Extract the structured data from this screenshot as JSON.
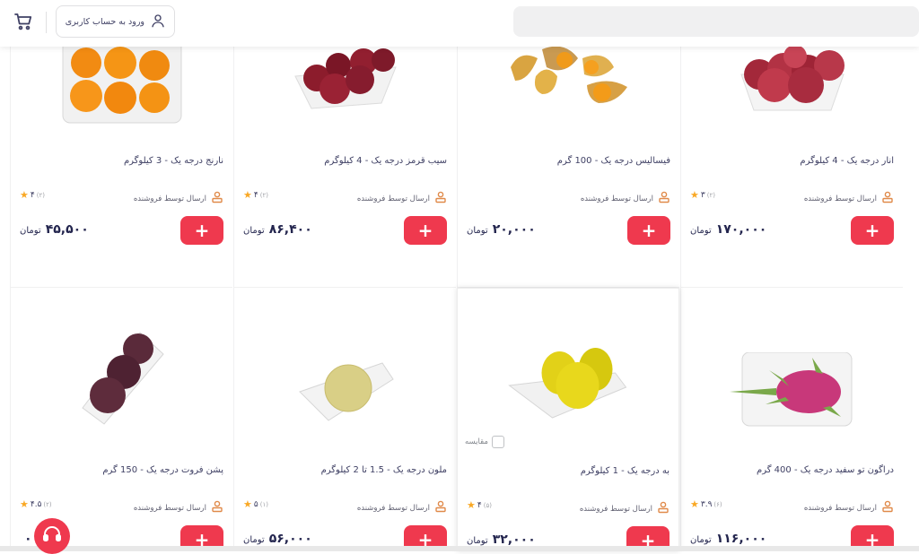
{
  "header": {
    "login_label": "ورود به حساب کاربری",
    "icons": {
      "cart": "cart-icon",
      "user": "user-icon"
    }
  },
  "colors": {
    "accent": "#ef394e",
    "star": "#f9a825",
    "text": "#23254e"
  },
  "products": [
    {
      "title": "انار درجه یک - 4 کیلوگرم",
      "seller": "ارسال توسط فروشنده",
      "rating": "۳",
      "rating_count": "(۲)",
      "price": "۱۷۰,۰۰۰",
      "currency": "تومان"
    },
    {
      "title": "فیسالیس درجه یک - 100 گرم",
      "seller": "ارسال توسط فروشنده",
      "price": "۲۰,۰۰۰",
      "currency": "تومان"
    },
    {
      "title": "سیب قرمز درجه یک - 4 کیلوگرم",
      "seller": "ارسال توسط فروشنده",
      "rating": "۴",
      "rating_count": "(۲)",
      "price": "۸۶,۴۰۰",
      "currency": "تومان"
    },
    {
      "title": "نارنج درجه یک - 3 کیلوگرم",
      "seller": "ارسال توسط فروشنده",
      "rating": "۴",
      "rating_count": "(۲)",
      "price": "۴۵,۵۰۰",
      "currency": "تومان"
    },
    {
      "title": "دراگون تو سفید درجه یک - 400 گرم",
      "seller": "ارسال توسط فروشنده",
      "rating": "۳.۹",
      "rating_count": "(۶)",
      "price": "۱۱۶,۰۰۰",
      "currency": "تومان"
    },
    {
      "title": "به درجه یک - 1 کیلوگرم",
      "seller": "ارسال توسط فروشنده",
      "rating": "۴",
      "rating_count": "(۵)",
      "price": "۳۲,۰۰۰",
      "currency": "تومان",
      "compare_label": "مقایسه"
    },
    {
      "title": "ملون درجه یک - 1.5 تا 2 کیلوگرم",
      "seller": "ارسال توسط فروشنده",
      "rating": "۵",
      "rating_count": "(۱)",
      "price": "۵۶,۰۰۰",
      "currency": "تومان"
    },
    {
      "title": "پشن فروت درجه یک - 150 گرم",
      "seller": "ارسال توسط فروشنده",
      "rating": "۴.۵",
      "rating_count": "(۲)",
      "price": "۰۰۰",
      "currency": ""
    }
  ]
}
